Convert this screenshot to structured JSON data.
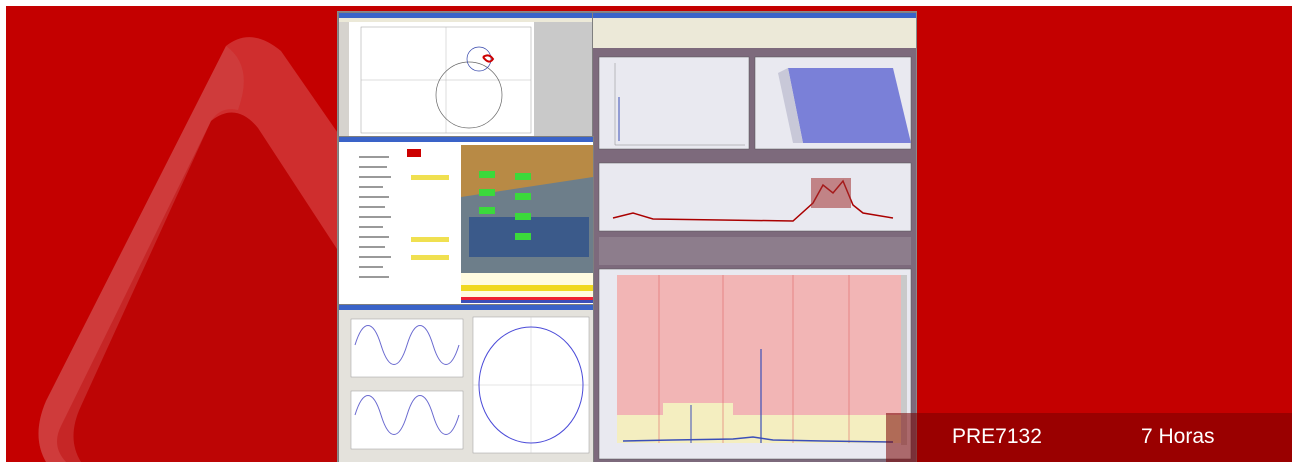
{
  "course": {
    "code": "PRE7132",
    "duration": "7 Horas"
  },
  "colors": {
    "background_red": "#c40000",
    "title_bar_blue": "#3a63c8",
    "panel_mauve": "#7d6a7c",
    "spectrum_blue": "#3b4fb8",
    "alarm_pink": "#f2b5b5",
    "alarm_yellow": "#f4eec0"
  },
  "screenshot": {
    "description_icons": [
      "orbit-plot",
      "waterfall-3d",
      "trend-plot",
      "spectrum-plot",
      "machine-photo",
      "waveform-plot"
    ]
  }
}
